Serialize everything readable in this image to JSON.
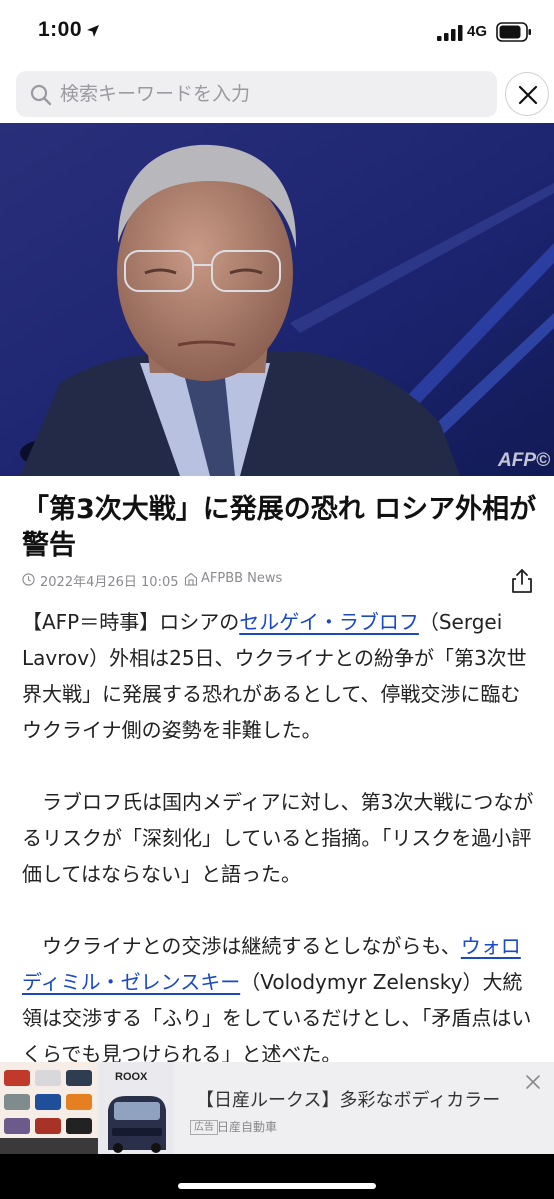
{
  "status_bar": {
    "time": "1:00",
    "network": "4G"
  },
  "search": {
    "placeholder": "検索キーワードを入力"
  },
  "hero": {
    "credit": "AFP©"
  },
  "article": {
    "title": "「第3次大戦」に発展の恐れ ロシア外相が警告",
    "date": "2022年4月26日 10:05",
    "source": "AFPBB News",
    "p1_a": "【AFP＝時事】ロシアの",
    "p1_link": "セルゲイ・ラブロフ",
    "p1_b": "（Sergei Lavrov）外相は25日、ウクライナとの紛争が「第3次世界大戦」に発展する恐れがあるとして、停戦交渉に臨むウクライナ側の姿勢を非難した。",
    "p2": "　ラブロフ氏は国内メディアに対し、第3次大戦につながるリスクが「深刻化」していると指摘。「リスクを過小評価してはならない」と語った。",
    "p3_a": "　ウクライナとの交渉は継続するとしながらも、",
    "p3_link": "ウォロディミル・ゼレンスキー",
    "p3_b": "（Volodymyr Zelensky）大統領は交渉する「ふり」をしているだけとし、「矛盾点はいくらでも見つけられる」と述べた。"
  },
  "ad": {
    "image_text": "ROOX",
    "title": "【日産ルークス】多彩なボディカラー",
    "label": "広告",
    "sponsor": "日産自動車"
  },
  "colors": {
    "link": "#1a49c8",
    "hero_bg": "#1b2569",
    "ad_bg": "#efeff1"
  }
}
